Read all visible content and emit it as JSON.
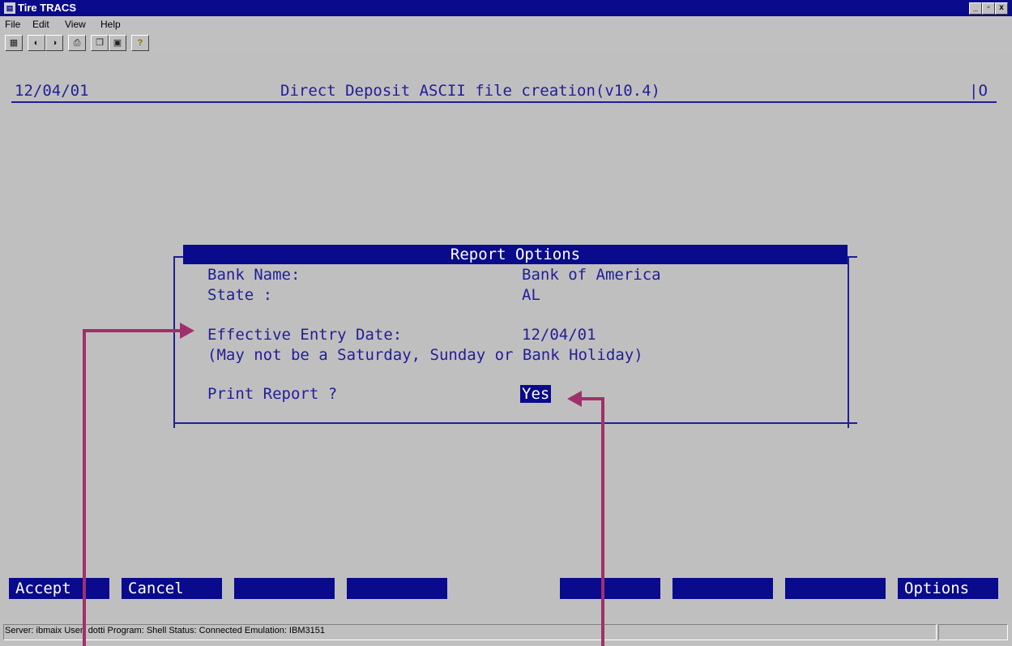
{
  "window": {
    "title": "Tire TRACS",
    "controls": [
      "_",
      "▫",
      "x"
    ]
  },
  "menu": [
    "File",
    "Edit",
    "View",
    "Help"
  ],
  "toolbar_icons": [
    "properties-icon",
    "connect-icon",
    "disconnect-icon",
    "print-icon",
    "copy-icon",
    "paste-icon",
    "help-icon"
  ],
  "header": {
    "date": "12/04/01",
    "title": "Direct Deposit ASCII file creation(v10.4)",
    "mode": "O"
  },
  "dialog": {
    "title": "Report Options",
    "bank_name_label": "Bank Name:",
    "bank_name_value": "Bank of America",
    "state_label": "State :",
    "state_value": "AL",
    "date_label": "Effective Entry Date:",
    "date_value": "12/04/01",
    "date_note": "(May not be a Saturday, Sunday or Bank Holiday)",
    "print_label": "Print Report ?",
    "print_value": "Yes"
  },
  "function_keys": [
    "Accept",
    "Cancel",
    "",
    "",
    "",
    "",
    "",
    "Options"
  ],
  "status": "Server: ibmaix   User: dotti   Program: Shell   Status: Connected   Emulation: IBM3151",
  "colors": {
    "terminal_text": "#1f1f96",
    "highlight": "#0a0a8c",
    "arrow": "#a0306a"
  }
}
